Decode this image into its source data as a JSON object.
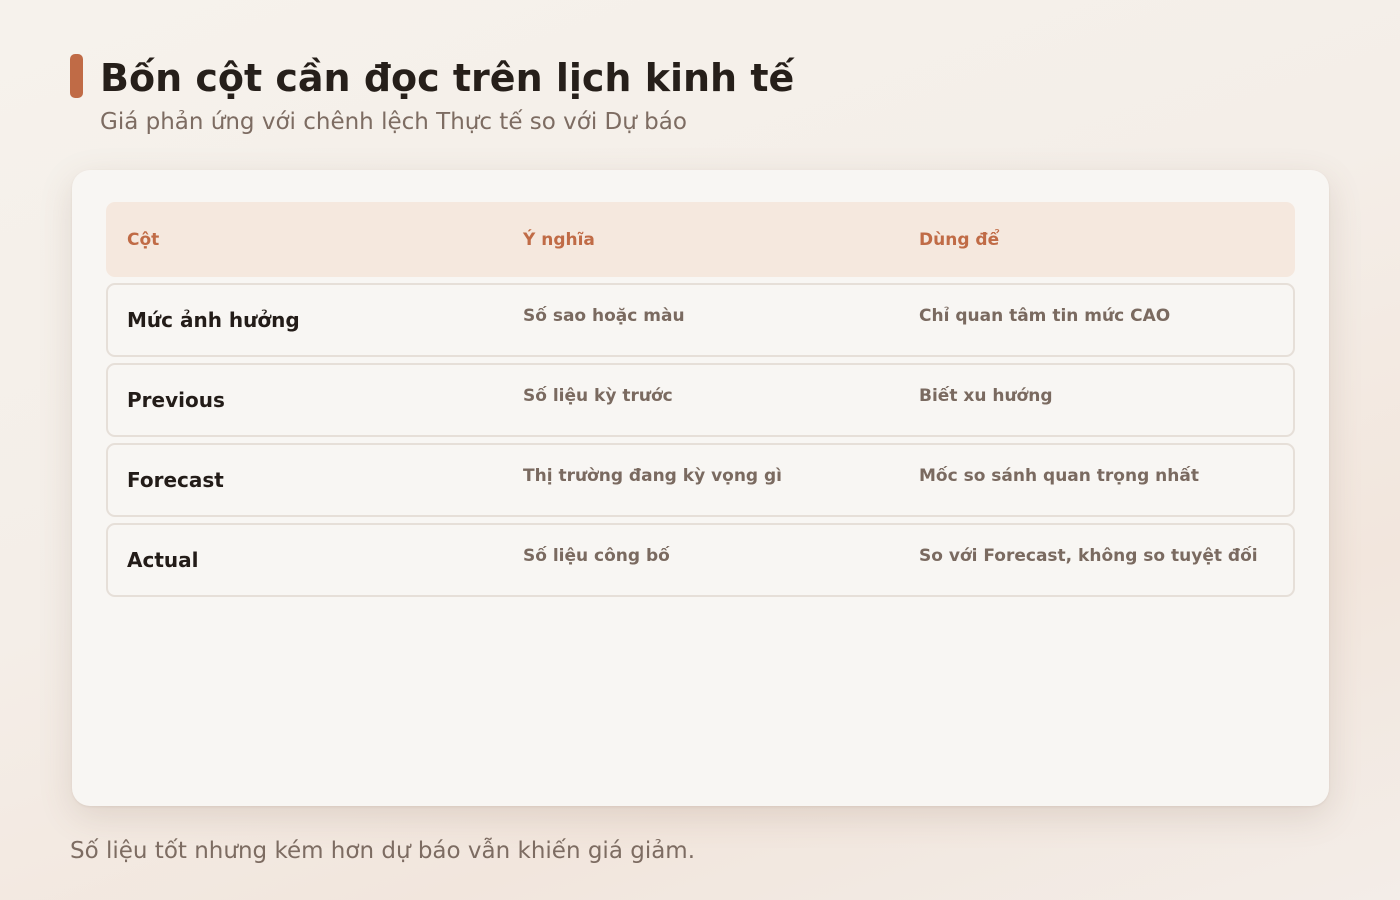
{
  "page": {
    "title": "Bốn cột cần đọc trên lịch kinh tế",
    "subtitle": "Giá phản ứng với chênh lệch Thực tế so với Dự báo",
    "footnote": "Số liệu tốt nhưng kém hơn dự báo vẫn khiến giá giảm."
  },
  "table": {
    "headers": [
      "Cột",
      "Ý nghĩa",
      "Dùng để"
    ],
    "rows": [
      {
        "name": "Mức ảnh hưởng",
        "meaning": "Số sao hoặc màu",
        "use": "Chỉ quan tâm tin mức CAO"
      },
      {
        "name": "Previous",
        "meaning": "Số liệu kỳ trước",
        "use": "Biết xu hướng"
      },
      {
        "name": "Forecast",
        "meaning": "Thị trường đang kỳ vọng gì",
        "use": "Mốc so sánh quan trọng nhất"
      },
      {
        "name": "Actual",
        "meaning": "Số liệu công bố",
        "use": "So với Forecast, không so tuyệt đối"
      }
    ]
  },
  "colors": {
    "accent": "#c06b46",
    "header_bg": "#f5e8de",
    "card_bg": "#f8f6f3",
    "row_border": "#e6dfd8",
    "muted_text": "#7a6a60"
  }
}
